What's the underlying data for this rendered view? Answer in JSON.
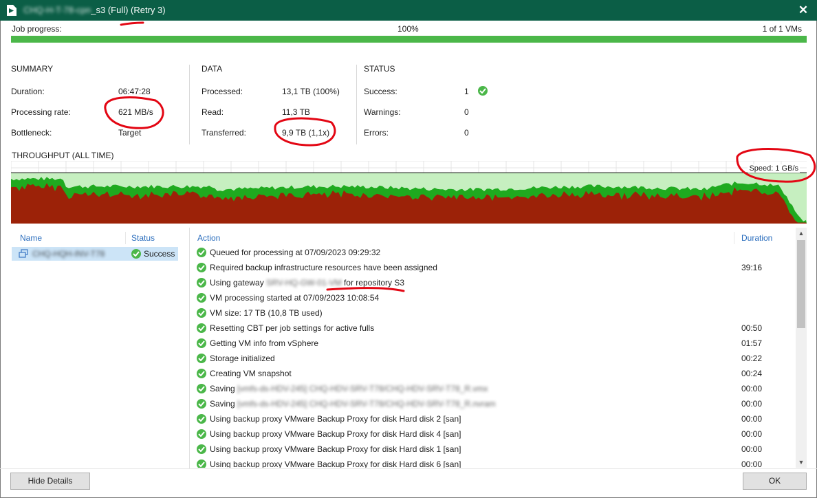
{
  "window": {
    "title_blurred": "CHQ-H-T-78-cpn",
    "title_suffix": "_s3 (Full) (Retry 3)",
    "close_glyph": "✕"
  },
  "progress": {
    "label": "Job progress:",
    "percent_text": "100%",
    "value": 1.0,
    "vms_text": "1 of 1 VMs"
  },
  "summary": {
    "heading": "SUMMARY",
    "duration_label": "Duration:",
    "duration_value": "06:47:28",
    "rate_label": "Processing rate:",
    "rate_value": "621 MB/s",
    "bottleneck_label": "Bottleneck:",
    "bottleneck_value": "Target"
  },
  "data": {
    "heading": "DATA",
    "processed_label": "Processed:",
    "processed_value": "13,1 TB (100%)",
    "read_label": "Read:",
    "read_value": "11,3 TB",
    "transferred_label": "Transferred:",
    "transferred_value": "9,9 TB (1,1x)"
  },
  "status": {
    "heading": "STATUS",
    "success_label": "Success:",
    "success_value": "1",
    "warnings_label": "Warnings:",
    "warnings_value": "0",
    "errors_label": "Errors:",
    "errors_value": "0"
  },
  "throughput": {
    "title": "THROUGHPUT (ALL TIME)",
    "speed_label": "Speed: 1 GB/s"
  },
  "vm_list": {
    "col_name": "Name",
    "col_status": "Status",
    "rows": [
      {
        "name_blurred": "CHQ-HQH-INV-T78",
        "status": "Success"
      }
    ]
  },
  "actions": {
    "col_action": "Action",
    "col_duration": "Duration",
    "rows": [
      {
        "text": "Queued for processing at 07/09/2023 09:29:32",
        "duration": ""
      },
      {
        "text": "Required backup infrastructure resources have been assigned",
        "duration": "39:16"
      },
      {
        "text_prefix": "Using gateway",
        "text_blurred": "SRV-HQ-GW-01-VM",
        "text_suffix": "for repository S3",
        "duration": ""
      },
      {
        "text": "VM processing started at 07/09/2023 10:08:54",
        "duration": ""
      },
      {
        "text": "VM size: 17 TB (10,8 TB used)",
        "duration": ""
      },
      {
        "text": "Resetting CBT per job settings for active fulls",
        "duration": "00:50"
      },
      {
        "text": "Getting VM info from vSphere",
        "duration": "01:57"
      },
      {
        "text": "Storage initialized",
        "duration": "00:22"
      },
      {
        "text": "Creating VM snapshot",
        "duration": "00:24"
      },
      {
        "text_prefix": "Saving",
        "text_blurred": "[vmfs-ds-HDV-245] CHQ-HDV-SRV-T78/CHQ-HDV-SRV-T78_R.vmx",
        "duration": "00:00"
      },
      {
        "text_prefix": "Saving",
        "text_blurred": "[vmfs-ds-HDV-245] CHQ-HDV-SRV-T78/CHQ-HDV-SRV-T78_R.nvram",
        "duration": "00:00"
      },
      {
        "text": "Using backup proxy VMware Backup Proxy for disk Hard disk 2 [san]",
        "duration": "00:00"
      },
      {
        "text": "Using backup proxy VMware Backup Proxy for disk Hard disk 4 [san]",
        "duration": "00:00"
      },
      {
        "text": "Using backup proxy VMware Backup Proxy for disk Hard disk 1 [san]",
        "duration": "00:00"
      },
      {
        "text": "Using backup proxy VMware Backup Proxy for disk Hard disk 6 [san]",
        "duration": "00:00"
      }
    ]
  },
  "buttons": {
    "hide_details": "Hide Details",
    "ok": "OK"
  },
  "colors": {
    "titlebar": "#0b5e46",
    "success_green": "#4bb749",
    "chart_read": "#1faa1f",
    "chart_transferred": "#9c2208",
    "chart_background": "#c6efc0",
    "annotation_red": "#e30613",
    "header_blue": "#2a6dbd"
  }
}
